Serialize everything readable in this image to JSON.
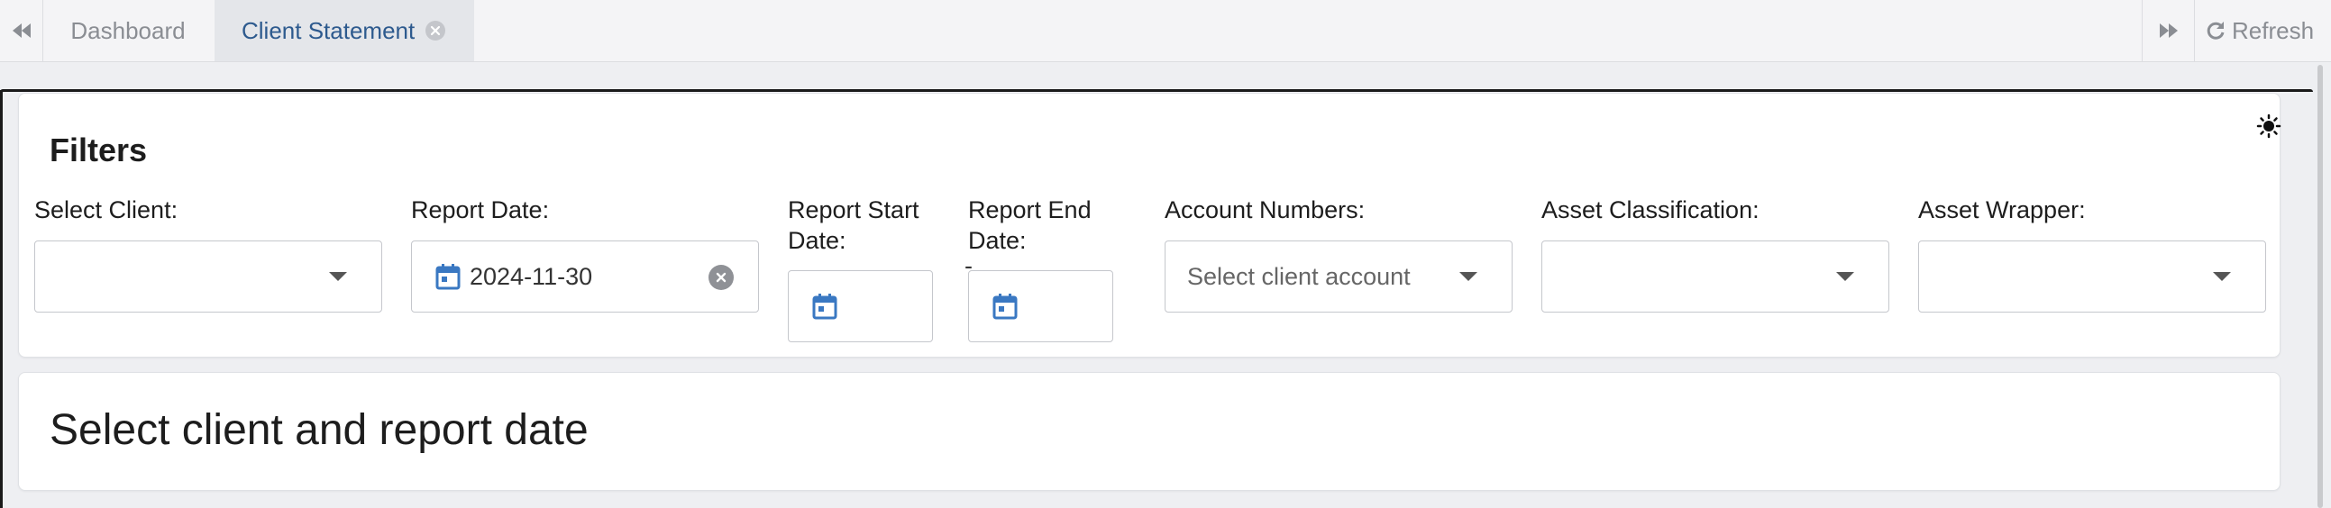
{
  "tabs": {
    "dashboard": "Dashboard",
    "client_statement": "Client Statement",
    "refresh": "Refresh"
  },
  "filters": {
    "title": "Filters",
    "select_client": {
      "label": "Select Client:",
      "value": ""
    },
    "report_date": {
      "label": "Report Date:",
      "value": "2024-11-30"
    },
    "report_start_date": {
      "label": "Report Start Date:",
      "value": ""
    },
    "report_end_date": {
      "label": "Report End Date:",
      "value": ""
    },
    "range_separator": "-",
    "account_numbers": {
      "label": "Account Numbers:",
      "placeholder": "Select client account"
    },
    "asset_classification": {
      "label": "Asset Classification:",
      "value": ""
    },
    "asset_wrapper": {
      "label": "Asset Wrapper:",
      "value": ""
    }
  },
  "message": "Select client and report date",
  "colors": {
    "accent": "#2d5a8e",
    "calendar_icon": "#3a78c2",
    "tab_active_bg": "#e4e6ea"
  },
  "icons": [
    "double-chevron-left-icon",
    "close-icon",
    "double-chevron-right-icon",
    "refresh-icon",
    "sun-icon",
    "calendar-icon",
    "clear-icon",
    "chevron-down-icon"
  ]
}
